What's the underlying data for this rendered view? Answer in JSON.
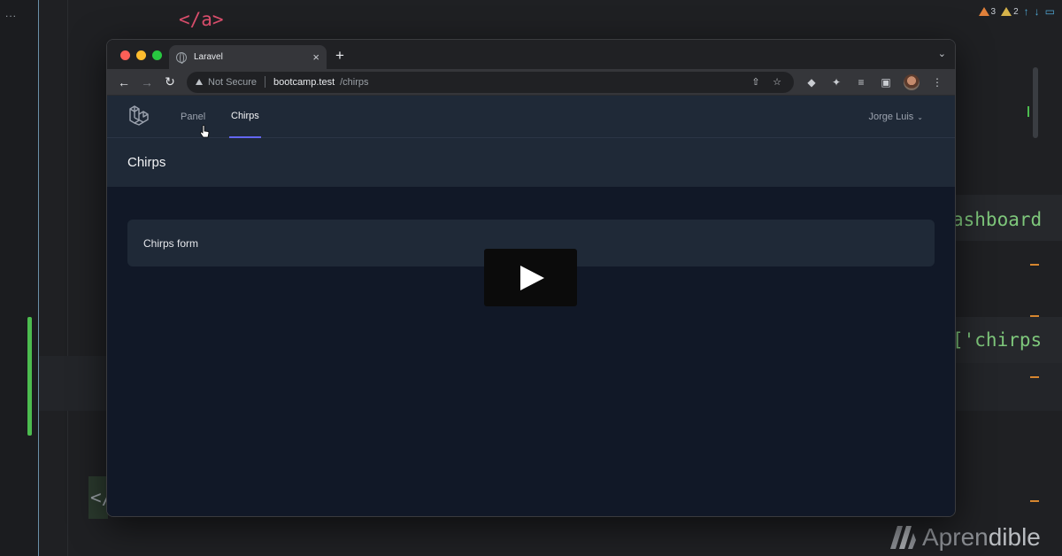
{
  "editor": {
    "gutter_menu": "...",
    "code_line_a": "</a>",
    "code_dashboard": "ashboard",
    "code_chirps": "['chirps",
    "code_close": "</",
    "warnings": {
      "orange_count": "3",
      "yellow_count": "2"
    }
  },
  "watermark": {
    "brand_a": "Apren",
    "brand_b": "dible"
  },
  "browser": {
    "tab_title": "Laravel",
    "tab_close": "×",
    "new_tab": "+",
    "tab_menu": "⌄",
    "security_label": "Not Secure",
    "url_host": "bootcamp.test",
    "url_path": "/chirps"
  },
  "app": {
    "nav": {
      "panel": "Panel",
      "chirps": "Chirps"
    },
    "user_name": "Jorge Luis",
    "page_title": "Chirps",
    "card_text": "Chirps form"
  },
  "colors": {
    "accent": "#6366f1",
    "nav_bg": "#1f2937",
    "content_bg": "#111827"
  }
}
